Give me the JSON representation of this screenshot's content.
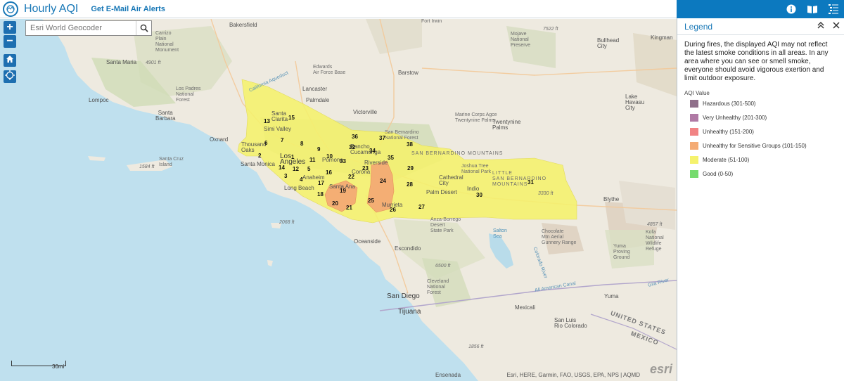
{
  "header": {
    "title": "Hourly AQI",
    "alerts_link": "Get E-Mail Air Alerts"
  },
  "toolbar": {
    "icons": [
      "info-icon",
      "book-icon",
      "list-icon"
    ]
  },
  "map": {
    "zoom_in": "+",
    "zoom_out": "−",
    "search_placeholder": "Esri World Geocoder",
    "scale_label": "30mi",
    "attribution": "Esri, HERE, Garmin, FAO, USGS, EPA, NPS | AQMD",
    "esri_logo": "esri",
    "places": {
      "bakersfield": "Bakersfield",
      "santa_maria": "Santa Maria",
      "lompoc": "Lompoc",
      "santa_barbara": "Santa\nBarbara",
      "oxnard": "Oxnard",
      "thousand_oaks": "Thousand\nOaks",
      "santa_monica": "Santa Monica",
      "santa_clarita": "Santa\nClarita",
      "simi_valley": "Simi Valley",
      "los_angeles": "Los\nAngeles",
      "long_beach": "Long Beach",
      "anaheim": "Anaheim",
      "santa_ana": "Santa Ana",
      "pomona": "Pomona",
      "rancho": "Rancho\nCucamonga",
      "riverside": "Riverside",
      "corona": "Corona",
      "murrieta": "Murrieta",
      "palm_desert": "Palm Desert",
      "cathedral_city": "Cathedral\nCity",
      "indio": "Indio",
      "oceanside": "Oceanside",
      "escondido": "Escondido",
      "san_diego": "San Diego",
      "tijuana": "Tijuana",
      "lancaster": "Lancaster",
      "palmdale": "Palmdale",
      "victorville": "Victorville",
      "barstow": "Barstow",
      "edwards": "Edwards\nAir Force Base",
      "marine_corps": "Marine Corps Agce\nTwentynine Palms",
      "twentynine_palms": "Twentynine\nPalms",
      "kingman": "Kingman",
      "bullhead": "Bullhead\nCity",
      "lake_havasu": "Lake\nHavasu\nCity",
      "blythe": "Blythe",
      "mexicali": "Mexicali",
      "yuma": "Yuma",
      "san_luis": "San Luis\nRio Colorado",
      "ensenada": "Ensenada",
      "santa_cruz_island": "Santa Cruz\nIsland",
      "mojave_preserve": "Mojave\nNational\nPreserve",
      "los_padres": "Los Padres\nNational\nForest",
      "carrizo": "Carrizo\nPlain\nNational\nMonument",
      "san_bernardino_forest": "San Bernardino\nNational Forest",
      "san_bernardino_mtns": "SAN BERNARDINO MOUNTAINS",
      "little_sb_mtns": "LITTLE\nSAN BERNARDINO\nMOUNTAINS",
      "joshua_tree": "Joshua Tree\nNational Park",
      "anza_borrego": "Anza-Borrego\nDesert\nState Park",
      "cleveland": "Cleveland\nNational\nForest",
      "salton_sea": "Salton\nSea",
      "chocolate_mtn": "Chocolate\nMtn Aerial\nGunnery Range",
      "kofa": "Kofa\nNational\nWildlife\nRefuge",
      "yuma_proving": "Yuma\nProving\nGround",
      "fort_irwin": "Fort Irwin",
      "usa": "UNITED STATES",
      "mexico": "MEXICO",
      "elev_7522": "7522 ft",
      "elev_4901": "4901 ft",
      "elev_1584": "1584 ft",
      "elev_2068": "2068 ft",
      "elev_6500": "6500 ft",
      "elev_4857": "4857 ft",
      "elev_1856": "1856 ft",
      "elev_3330": "3330 ft",
      "colorado_river": "Colorado River",
      "gila_river": "Gila River",
      "all_american_canal": "All American Canal",
      "california_aqueduct": "California Aqueduct"
    },
    "zones": [
      "1",
      "2",
      "3",
      "4",
      "5",
      "6",
      "7",
      "8",
      "9",
      "10",
      "11",
      "12",
      "13",
      "14",
      "15",
      "16",
      "17",
      "18",
      "19",
      "20",
      "21",
      "22",
      "23",
      "24",
      "25",
      "26",
      "27",
      "28",
      "29",
      "30",
      "31",
      "32",
      "33",
      "34",
      "35",
      "36",
      "37",
      "38"
    ]
  },
  "legend": {
    "title": "Legend",
    "collapse_icon": "«",
    "close_icon": "×",
    "notice": "During fires, the displayed AQI may not reflect the latest smoke conditions in all areas. In any area where you can see or smell smoke, everyone should avoid vigorous exertion and limit outdoor exposure.",
    "aqi_title": "AQI Value",
    "items": [
      {
        "label": "Hazardous (301-500)",
        "color": "#8f6f8a"
      },
      {
        "label": "Very Unhealthy (201-300)",
        "color": "#b07aa5"
      },
      {
        "label": "Unhealthy (151-200)",
        "color": "#f18384"
      },
      {
        "label": "Unhealthy for Sensitive Groups (101-150)",
        "color": "#f4ab74"
      },
      {
        "label": "Moderate (51-100)",
        "color": "#f5f26d"
      },
      {
        "label": "Good (0-50)",
        "color": "#76db6e"
      }
    ]
  }
}
